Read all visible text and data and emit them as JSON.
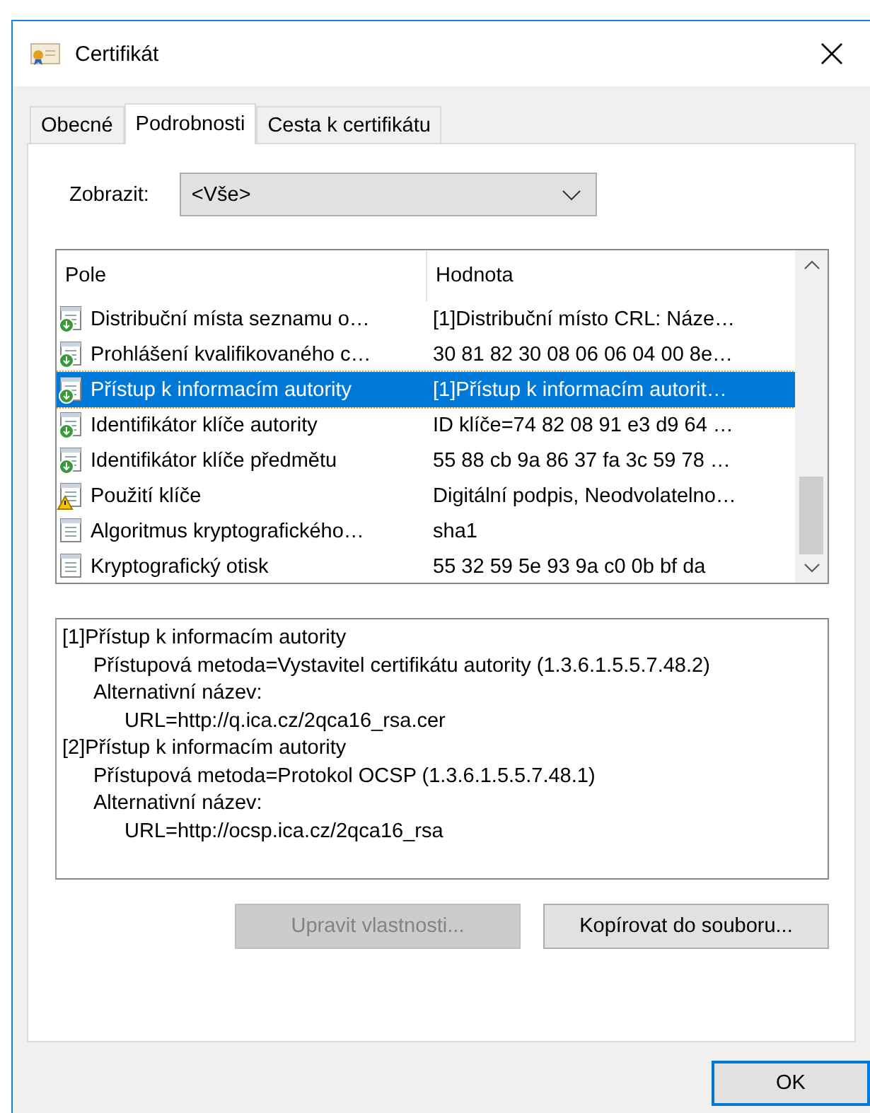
{
  "window": {
    "title": "Certifikát"
  },
  "tabs": [
    {
      "label": "Obecné",
      "selected": false
    },
    {
      "label": "Podrobnosti",
      "selected": true
    },
    {
      "label": "Cesta k certifikátu",
      "selected": false
    }
  ],
  "show": {
    "label": "Zobrazit:",
    "value": "<Vše>"
  },
  "table": {
    "columns": [
      "Pole",
      "Hodnota"
    ],
    "rows": [
      {
        "kind": "extension",
        "field": "Distribuční místa seznamu o…",
        "value": "[1]Distribuční místo CRL: Náze…",
        "selected": false
      },
      {
        "kind": "extension",
        "field": "Prohlášení kvalifikovaného c…",
        "value": "30 81 82 30 08 06 06 04 00 8e…",
        "selected": false
      },
      {
        "kind": "extension",
        "field": "Přístup k informacím autority",
        "value": "[1]Přístup k informacím autorit…",
        "selected": true
      },
      {
        "kind": "extension",
        "field": "Identifikátor klíče autority",
        "value": "ID klíče=74 82 08 91 e3 d9 64 …",
        "selected": false
      },
      {
        "kind": "extension",
        "field": "Identifikátor klíče předmětu",
        "value": "55 88 cb 9a 86 37 fa 3c 59 78 …",
        "selected": false
      },
      {
        "kind": "warning",
        "field": "Použití klíče",
        "value": "Digitální podpis, Neodvolatelno…",
        "selected": false
      },
      {
        "kind": "plain",
        "field": "Algoritmus kryptografického…",
        "value": "sha1",
        "selected": false
      },
      {
        "kind": "plain",
        "field": "Kryptografický otisk",
        "value": "55 32 59 5e 93 9a c0 0b bf da",
        "selected": false
      }
    ]
  },
  "details": [
    {
      "text": "[1]Přístup k informacím autority",
      "children": [
        {
          "text": "Přístupová metoda=Vystavitel certifikátu autority (1.3.6.1.5.5.7.48.2)"
        },
        {
          "text": "Alternativní název:",
          "children": [
            {
              "text": "URL=http://q.ica.cz/2qca16_rsa.cer"
            }
          ]
        }
      ]
    },
    {
      "text": "[2]Přístup k informacím autority",
      "children": [
        {
          "text": "Přístupová metoda=Protokol OCSP (1.3.6.1.5.5.7.48.1)"
        },
        {
          "text": "Alternativní název:",
          "children": [
            {
              "text": "URL=http://ocsp.ica.cz/2qca16_rsa"
            }
          ]
        }
      ]
    }
  ],
  "buttons": [
    {
      "label": "Upravit vlastnosti...",
      "disabled": true
    },
    {
      "label": "Kopírovat do souboru...",
      "disabled": false
    }
  ],
  "ok": {
    "label": "OK"
  }
}
